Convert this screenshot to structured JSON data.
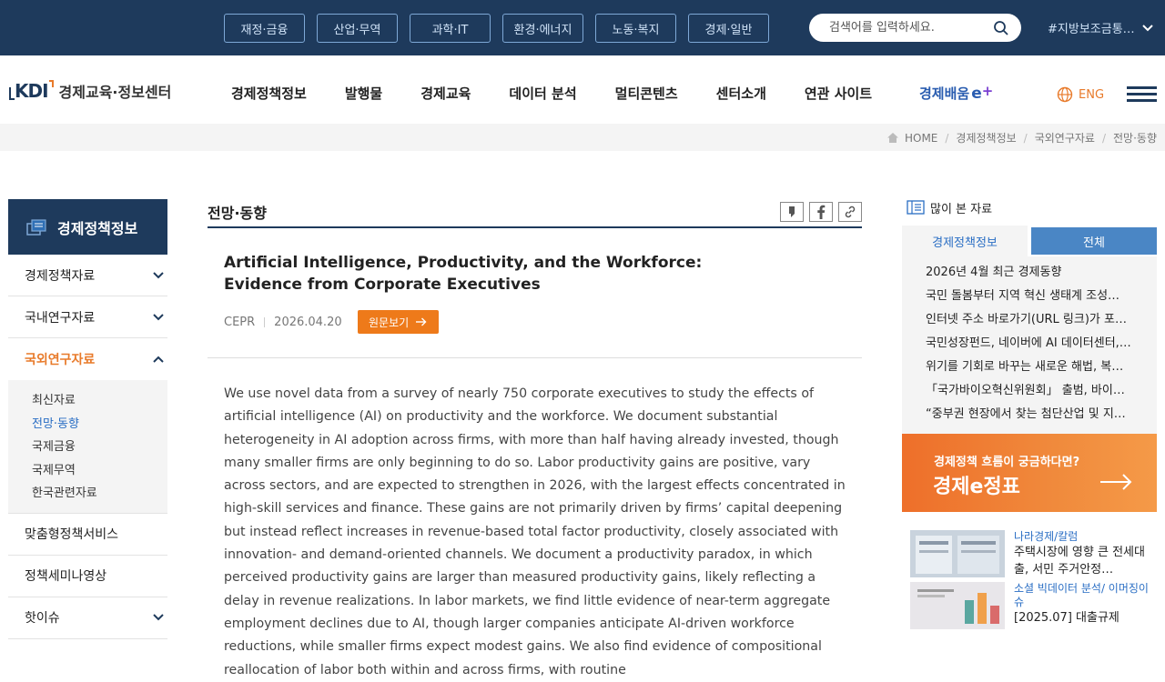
{
  "topbar": {
    "categories": [
      "재정·금융",
      "산업·무역",
      "과학·IT",
      "환경·에너지",
      "노동·복지",
      "경제·일반"
    ],
    "search_placeholder": "검색어를 입력하세요.",
    "hashtag": "#지방보조금통…"
  },
  "header": {
    "logo_mark": "KDI",
    "logo_name": "경제교육·정보센터",
    "nav": [
      "경제정책정보",
      "발행물",
      "경제교육",
      "데이터 분석",
      "멀티콘텐츠",
      "센터소개",
      "연관 사이트"
    ],
    "eplus_label": "경제배움",
    "eplus_e": "e",
    "eplus_plus": "+",
    "lang": "ENG"
  },
  "breadcrumb": [
    "HOME",
    "경제정책정보",
    "국외연구자료",
    "전망·동향"
  ],
  "sidebar": {
    "title": "경제정책정보",
    "items": [
      {
        "label": "경제정책자료"
      },
      {
        "label": "국내연구자료"
      },
      {
        "label": "국외연구자료"
      },
      {
        "label": "맞춤형정책서비스"
      },
      {
        "label": "정책세미나영상"
      },
      {
        "label": "핫이슈"
      }
    ],
    "sub_items": [
      "최신자료",
      "전망·동향",
      "국제금융",
      "국제무역",
      "한국관련자료"
    ]
  },
  "content": {
    "section_title": "전망·동향",
    "article_title": "Artificial Intelligence, Productivity, and the Workforce: Evidence from Corporate Executives",
    "source": "CEPR",
    "date": "2026.04.20",
    "original_button": "원문보기",
    "abstract": "We use novel data from a survey of nearly 750 corporate executives to study the effects of artificial intelligence (AI) on productivity and the workforce. We document substantial heterogeneity in AI adoption across firms, with more than half having already invested, though many smaller firms are only beginning to do so. Labor productivity gains are positive, vary across sectors, and are expected to strengthen in 2026, with the largest effects concentrated in high-skill services and finance. These gains are not primarily driven by firms’ capital deepening but instead reflect increases in revenue-based total factor productivity, closely associated with innovation- and demand-oriented channels. We document a productivity paradox, in which perceived productivity gains are larger than measured productivity gains, likely reflecting a delay in revenue realizations. In labor markets, we find little evidence of near-term aggregate employment declines due to AI, though larger companies anticipate AI-driven workforce reductions, while smaller firms expect modest gains. We also find evidence of compositional reallocation of labor both within and across firms, with routine"
  },
  "right": {
    "popular_title": "많이 본 자료",
    "tabs": [
      "경제정책정보",
      "전체"
    ],
    "popular_items": [
      "2026년 4월 최근 경제동향",
      "국민 돌봄부터 지역 혁신 생태계 조성…",
      "인터넷 주소 바로가기(URL 링크)가 포…",
      "국민성장펀드, 네이버에 AI 데이터센터,…",
      "위기를 기회로 바꾸는 새로운 해법, 복…",
      "「국가바이오혁신위원회」 출범, 바이오 …",
      "“중부권 현장에서 찾는 첨단산업 및 지…"
    ],
    "banner_line1": "경제정책 흐름이 궁금하다면?",
    "banner_line2": "경제e정표",
    "news": [
      {
        "category": "나라경제/칼럼",
        "title": "주택시장에 영향 큰 전세대출, 서민 주거안정…"
      },
      {
        "category": "소셜 빅데이터 분석/ 이머징이슈",
        "title": "[2025.07] 대출규제"
      }
    ]
  },
  "colors": {
    "navy": "#1e3a5c",
    "orange": "#ee7a1a",
    "blue": "#2a6ec4"
  }
}
